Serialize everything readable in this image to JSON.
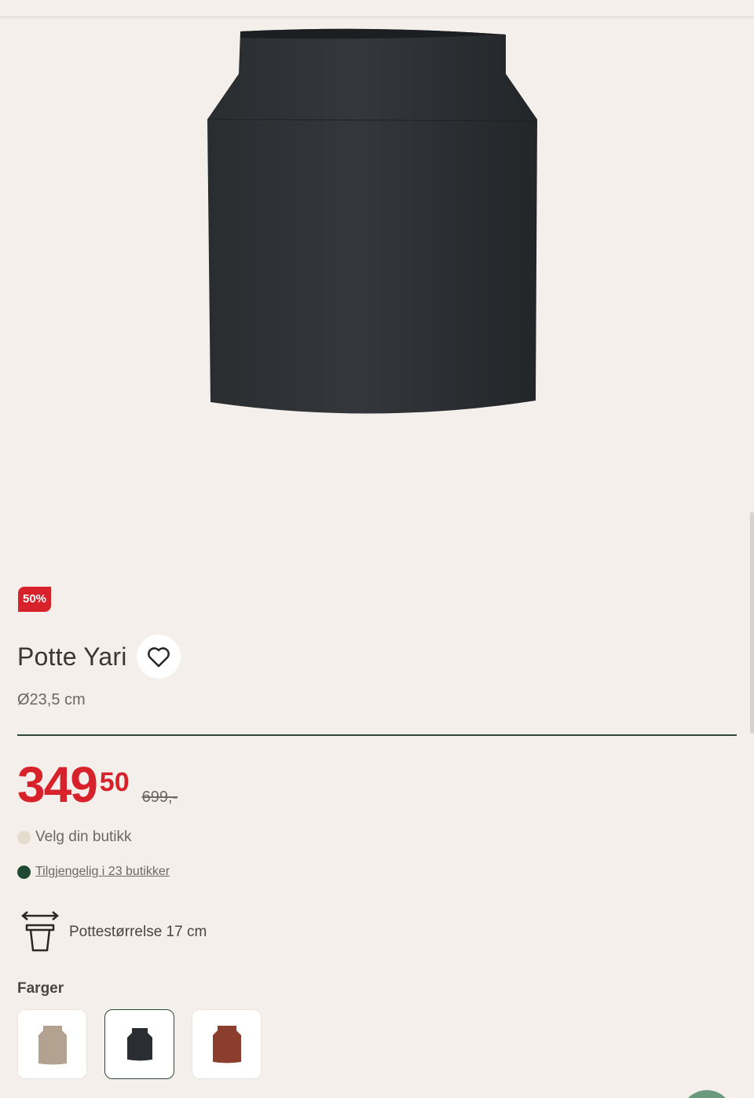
{
  "product": {
    "discount_badge": "50%",
    "title": "Potte Yari",
    "subtitle": "Ø23,5 cm",
    "price_main": "349",
    "price_cents": "50",
    "price_old": "699,-"
  },
  "store": {
    "choose_label": "Velg din butikk",
    "availability_link": "Tilgjengelig i 23 butikker"
  },
  "pot_size": {
    "label": "Pottestørrelse 17 cm",
    "icon": "pot-size-icon"
  },
  "colors": {
    "label": "Farger",
    "options": [
      {
        "name": "beige",
        "color": "#b3a290"
      },
      {
        "name": "black",
        "color": "#2a2d31"
      },
      {
        "name": "terracotta",
        "color": "#8b3d2e"
      }
    ],
    "selected_index": 1
  },
  "theme": {
    "accent_red": "#d8222b",
    "accent_green": "#2e4a3a"
  }
}
